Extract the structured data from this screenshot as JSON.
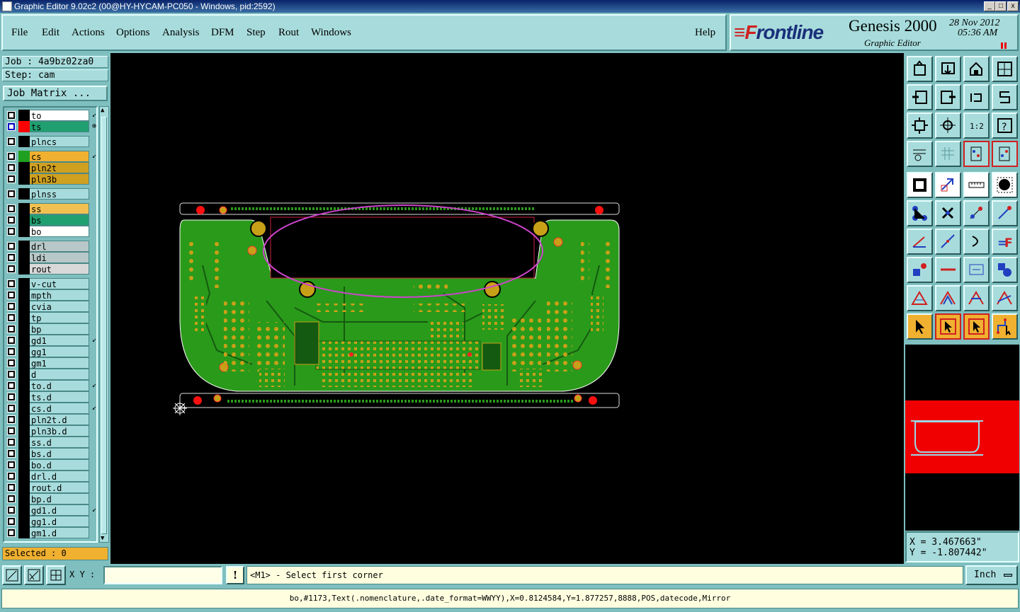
{
  "window": {
    "title": "Graphic Editor 9.02c2 (00@HY-HYCAM-PC050 - Windows, pid:2592)",
    "controls": [
      "_",
      "□",
      "x"
    ]
  },
  "menu": {
    "items": [
      "File",
      "Edit",
      "Actions",
      "Options",
      "Analysis",
      "DFM",
      "Step",
      "Rout",
      "Windows"
    ],
    "help": "Help"
  },
  "brand": {
    "logo_f": "≡F",
    "logo_rest": "rontline",
    "product": "Genesis 2000",
    "subtitle": "Graphic Editor",
    "date": "28 Nov 2012",
    "time": "05:36 AM"
  },
  "job": {
    "job_label": "Job : 4a9bz02za0",
    "step_label": "Step: cam",
    "matrix_button": "Job Matrix ..."
  },
  "layers": [
    {
      "name": "to",
      "bg": "#ffffff",
      "swatch": "#000000",
      "flag": "↙",
      "checked": false
    },
    {
      "name": "ts",
      "bg": "#20a070",
      "swatch": "#ff0000",
      "flag": "⊕",
      "checked": true
    },
    {
      "name": "plncs",
      "bg": "#a8dcdc",
      "swatch": "#000000",
      "flag": "",
      "checked": false
    },
    {
      "name": "cs",
      "bg": "#f0b030",
      "swatch": "#20a020",
      "flag": "↙",
      "checked": false
    },
    {
      "name": "pln2t",
      "bg": "#d0a020",
      "swatch": "#000000",
      "flag": "",
      "checked": false
    },
    {
      "name": "pln3b",
      "bg": "#d0a020",
      "swatch": "#000000",
      "flag": "",
      "checked": false
    },
    {
      "name": "plnss",
      "bg": "#a8dcdc",
      "swatch": "#000000",
      "flag": "",
      "checked": false
    },
    {
      "name": "ss",
      "bg": "#f0c050",
      "swatch": "#000000",
      "flag": "",
      "checked": false
    },
    {
      "name": "bs",
      "bg": "#20a070",
      "swatch": "#000000",
      "flag": "",
      "checked": false
    },
    {
      "name": "bo",
      "bg": "#ffffff",
      "swatch": "#000000",
      "flag": "",
      "checked": false
    },
    {
      "name": "drl",
      "bg": "#b8c8c8",
      "swatch": "#000000",
      "flag": "",
      "checked": false
    },
    {
      "name": "ldi",
      "bg": "#b8c8c8",
      "swatch": "#000000",
      "flag": "",
      "checked": false
    },
    {
      "name": "rout",
      "bg": "#d8d8d8",
      "swatch": "#000000",
      "flag": "",
      "checked": false
    },
    {
      "name": "v-cut",
      "bg": "#a8dcdc",
      "swatch": "#000000",
      "flag": "",
      "checked": false
    },
    {
      "name": "mpth",
      "bg": "#a8dcdc",
      "swatch": "#000000",
      "flag": "",
      "checked": false
    },
    {
      "name": "cvia",
      "bg": "#a8dcdc",
      "swatch": "#000000",
      "flag": "",
      "checked": false
    },
    {
      "name": "tp",
      "bg": "#a8dcdc",
      "swatch": "#000000",
      "flag": "",
      "checked": false
    },
    {
      "name": "bp",
      "bg": "#a8dcdc",
      "swatch": "#000000",
      "flag": "",
      "checked": false
    },
    {
      "name": "gd1",
      "bg": "#a8dcdc",
      "swatch": "#000000",
      "flag": "↙",
      "checked": false
    },
    {
      "name": "gg1",
      "bg": "#a8dcdc",
      "swatch": "#000000",
      "flag": "",
      "checked": false
    },
    {
      "name": "gm1",
      "bg": "#a8dcdc",
      "swatch": "#000000",
      "flag": "",
      "checked": false
    },
    {
      "name": "d",
      "bg": "#a8dcdc",
      "swatch": "#000000",
      "flag": "",
      "checked": false
    },
    {
      "name": "to.d",
      "bg": "#a8dcdc",
      "swatch": "#000000",
      "flag": "↙",
      "checked": false
    },
    {
      "name": "ts.d",
      "bg": "#a8dcdc",
      "swatch": "#000000",
      "flag": "",
      "checked": false
    },
    {
      "name": "cs.d",
      "bg": "#a8dcdc",
      "swatch": "#000000",
      "flag": "↙",
      "checked": false
    },
    {
      "name": "pln2t.d",
      "bg": "#a8dcdc",
      "swatch": "#000000",
      "flag": "",
      "checked": false
    },
    {
      "name": "pln3b.d",
      "bg": "#a8dcdc",
      "swatch": "#000000",
      "flag": "",
      "checked": false
    },
    {
      "name": "ss.d",
      "bg": "#a8dcdc",
      "swatch": "#000000",
      "flag": "",
      "checked": false
    },
    {
      "name": "bs.d",
      "bg": "#a8dcdc",
      "swatch": "#000000",
      "flag": "",
      "checked": false
    },
    {
      "name": "bo.d",
      "bg": "#a8dcdc",
      "swatch": "#000000",
      "flag": "",
      "checked": false
    },
    {
      "name": "drl.d",
      "bg": "#a8dcdc",
      "swatch": "#000000",
      "flag": "",
      "checked": false
    },
    {
      "name": "rout.d",
      "bg": "#a8dcdc",
      "swatch": "#000000",
      "flag": "",
      "checked": false
    },
    {
      "name": "bp.d",
      "bg": "#a8dcdc",
      "swatch": "#000000",
      "flag": "",
      "checked": false
    },
    {
      "name": "gd1.d",
      "bg": "#a8dcdc",
      "swatch": "#000000",
      "flag": "↙",
      "checked": false
    },
    {
      "name": "gg1.d",
      "bg": "#a8dcdc",
      "swatch": "#000000",
      "flag": "",
      "checked": false
    },
    {
      "name": "gm1.d",
      "bg": "#a8dcdc",
      "swatch": "#000000",
      "flag": "",
      "checked": false
    }
  ],
  "selected": "Selected : 0",
  "coords": {
    "x": "X = 3.467663\"",
    "y": "Y = -1.807442\""
  },
  "toolbar_icons": [
    "zoom-home-icon",
    "zoom-step-icon",
    "home-icon",
    "split-view-icon",
    "pan-left-icon",
    "pan-right-icon",
    "undo-icon",
    "snap-icon",
    "fit-icon",
    "center-icon",
    "scale-1to2-icon",
    "help-icon",
    "properties-icon",
    "grid-icon",
    "layer-compare-icon",
    "layer-compare-alt-icon",
    "measure-icon",
    "edit-shape-icon",
    "ruler-icon",
    "pad-icon",
    "connect-icon",
    "cross-icon",
    "line-point-icon",
    "line-dot-icon",
    "angle-icon",
    "slope-icon",
    "arc-icon",
    "mirror-f-icon",
    "square-dot-icon",
    "line-width-icon",
    "dimension-icon",
    "shapes-icon",
    "triangle-a-icon",
    "triangle-b-icon",
    "triangle-c-icon",
    "triangle-d-icon",
    "select-arrow-icon",
    "select-box-icon",
    "select-net-icon",
    "select-route-icon"
  ],
  "bottom": {
    "xy_label": "X Y :",
    "xy_value": "",
    "warn": "!",
    "prompt": "<M1> - Select first corner",
    "units": "Inch"
  },
  "status": "bo,#1173,Text(.nomenclature,.date_format=WWYY),X=0.8124584,Y=1.877257,8888,POS,datecode,Mirror",
  "colors": {
    "panel": "#7fbfbf",
    "board_green": "#2a9a1a",
    "pad_gold": "#c8a018",
    "highlight": "#cc44cc"
  }
}
